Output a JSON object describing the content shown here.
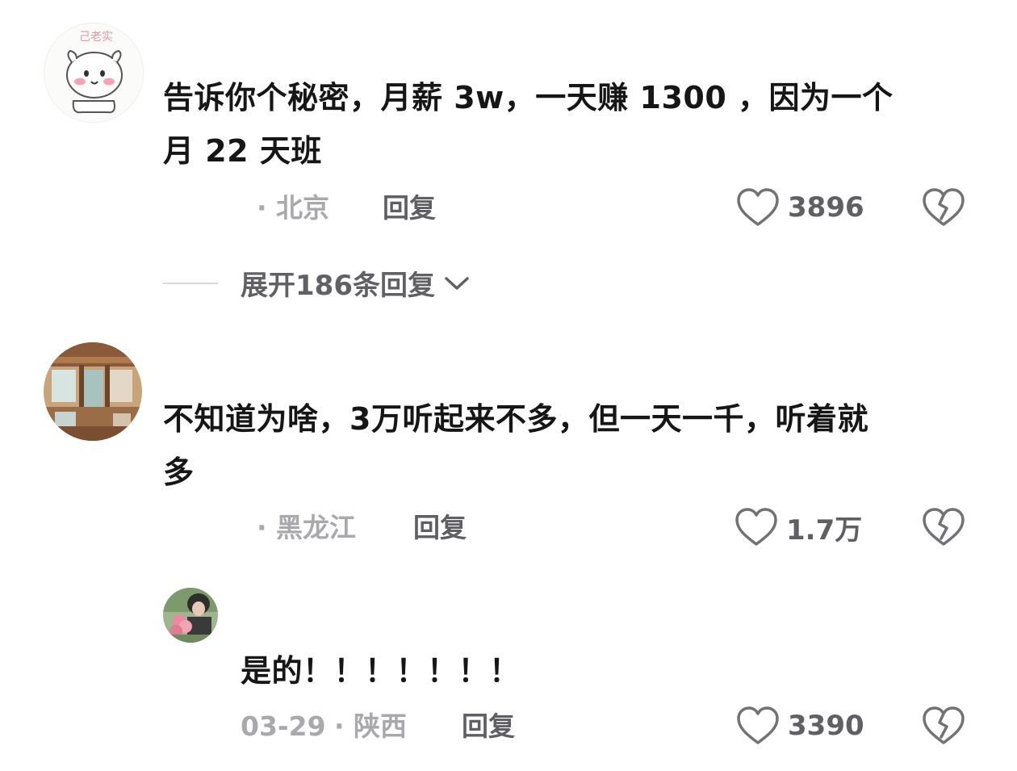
{
  "comments": [
    {
      "avatar_label": "己老实",
      "text_line1": "告诉你个秘密，月薪 3w，一天赚 1300 ，因为一个",
      "text_line2": "月 22 天班",
      "location": "· 北京",
      "reply_label": "回复",
      "likes": "3896",
      "expand_label": "展开186条回复"
    },
    {
      "text_line1": "不知道为啥，3万听起来不多，但一天一千，听着就",
      "text_line2": "多",
      "location": "· 黑龙江",
      "reply_label": "回复",
      "likes": "1.7万"
    },
    {
      "text": "是的！！！！！！！",
      "date": "03-29",
      "location": "· 陕西",
      "reply_label": "回复",
      "likes": "3390"
    }
  ],
  "icons": {
    "like": "heart-outline-icon",
    "dislike": "broken-heart-icon",
    "expand": "chevron-down-icon"
  },
  "colors": {
    "text": "#161616",
    "meta": "#a9a9ad",
    "action": "#5f5f63",
    "icon": "#727276"
  }
}
